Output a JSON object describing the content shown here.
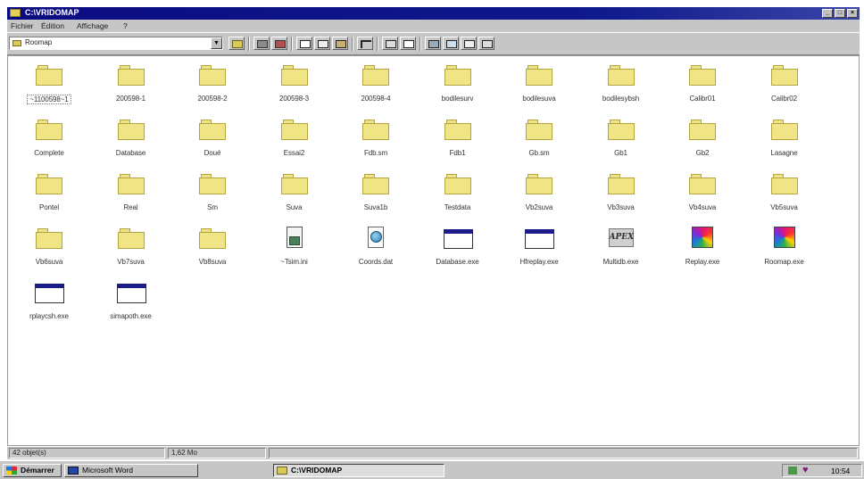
{
  "window": {
    "title": "C:\\VRIDOMAP",
    "controls": [
      "_",
      "□",
      "×"
    ]
  },
  "menu": [
    "Fichier",
    "Édition",
    "Affichage",
    "?"
  ],
  "toolbar": {
    "address_value": "Roomap"
  },
  "rows": [
    [
      {
        "label": "~1100598~1",
        "icon": "folder-icon",
        "selected": true
      },
      {
        "label": "200598-1",
        "icon": "folder-icon"
      },
      {
        "label": "200598-2",
        "icon": "folder-icon"
      },
      {
        "label": "200598-3",
        "icon": "folder-icon"
      },
      {
        "label": "200598-4",
        "icon": "folder-icon"
      },
      {
        "label": "bodilesurv",
        "icon": "folder-icon"
      },
      {
        "label": "bodilesuva",
        "icon": "folder-icon"
      },
      {
        "label": "bodilesybsh",
        "icon": "folder-icon"
      },
      {
        "label": "Calibr01",
        "icon": "folder-icon"
      },
      {
        "label": "Calibr02",
        "icon": "folder-icon"
      }
    ],
    [
      {
        "label": "Complete",
        "icon": "folder-icon"
      },
      {
        "label": "Database",
        "icon": "folder-icon"
      },
      {
        "label": "Doué",
        "icon": "folder-icon"
      },
      {
        "label": "Essai2",
        "icon": "folder-icon"
      },
      {
        "label": "Fdb.sm",
        "icon": "folder-icon"
      },
      {
        "label": "Fdb1",
        "icon": "folder-icon"
      },
      {
        "label": "Gb.sm",
        "icon": "folder-icon"
      },
      {
        "label": "Gb1",
        "icon": "folder-icon"
      },
      {
        "label": "Gb2",
        "icon": "folder-icon"
      },
      {
        "label": "Lasagne",
        "icon": "folder-icon"
      }
    ],
    [
      {
        "label": "Pontel",
        "icon": "folder-icon"
      },
      {
        "label": "Real",
        "icon": "folder-icon"
      },
      {
        "label": "Sm",
        "icon": "folder-icon"
      },
      {
        "label": "Suva",
        "icon": "folder-icon"
      },
      {
        "label": "Suva1b",
        "icon": "folder-icon"
      },
      {
        "label": "Testdata",
        "icon": "folder-icon"
      },
      {
        "label": "Vb2suva",
        "icon": "folder-icon"
      },
      {
        "label": "Vb3suva",
        "icon": "folder-icon"
      },
      {
        "label": "Vb4suva",
        "icon": "folder-icon"
      },
      {
        "label": "Vb5suva",
        "icon": "folder-icon"
      }
    ],
    [
      {
        "label": "Vb6suva",
        "icon": "folder-icon"
      },
      {
        "label": "Vb7suva",
        "icon": "folder-icon"
      },
      {
        "label": "Vb8suva",
        "icon": "folder-icon"
      },
      {
        "label": "~Tsim.ini",
        "icon": "ini-file-icon"
      },
      {
        "label": "Coords.dat",
        "icon": "dat-file-icon"
      },
      {
        "label": "Database.exe",
        "icon": "exe-window-icon"
      },
      {
        "label": "Hfreplay.exe",
        "icon": "exe-window-icon"
      },
      {
        "label": "Multidb.exe",
        "icon": "multidb-logo-icon"
      },
      {
        "label": "Replay.exe",
        "icon": "replay-app-icon"
      },
      {
        "label": "Roomap.exe",
        "icon": "replay-app-icon"
      }
    ],
    [
      {
        "label": "rplaycsh.exe",
        "icon": "exe-window-icon"
      },
      {
        "label": "simapoth.exe",
        "icon": "exe-window-icon"
      }
    ]
  ],
  "status": {
    "objects": "42 objet(s)",
    "size": "1,62 Mo"
  },
  "taskbar": {
    "start": "Démarrer",
    "tasks": [
      "Microsoft Word",
      "C:\\VRIDOMAP"
    ],
    "clock": "10:54"
  }
}
